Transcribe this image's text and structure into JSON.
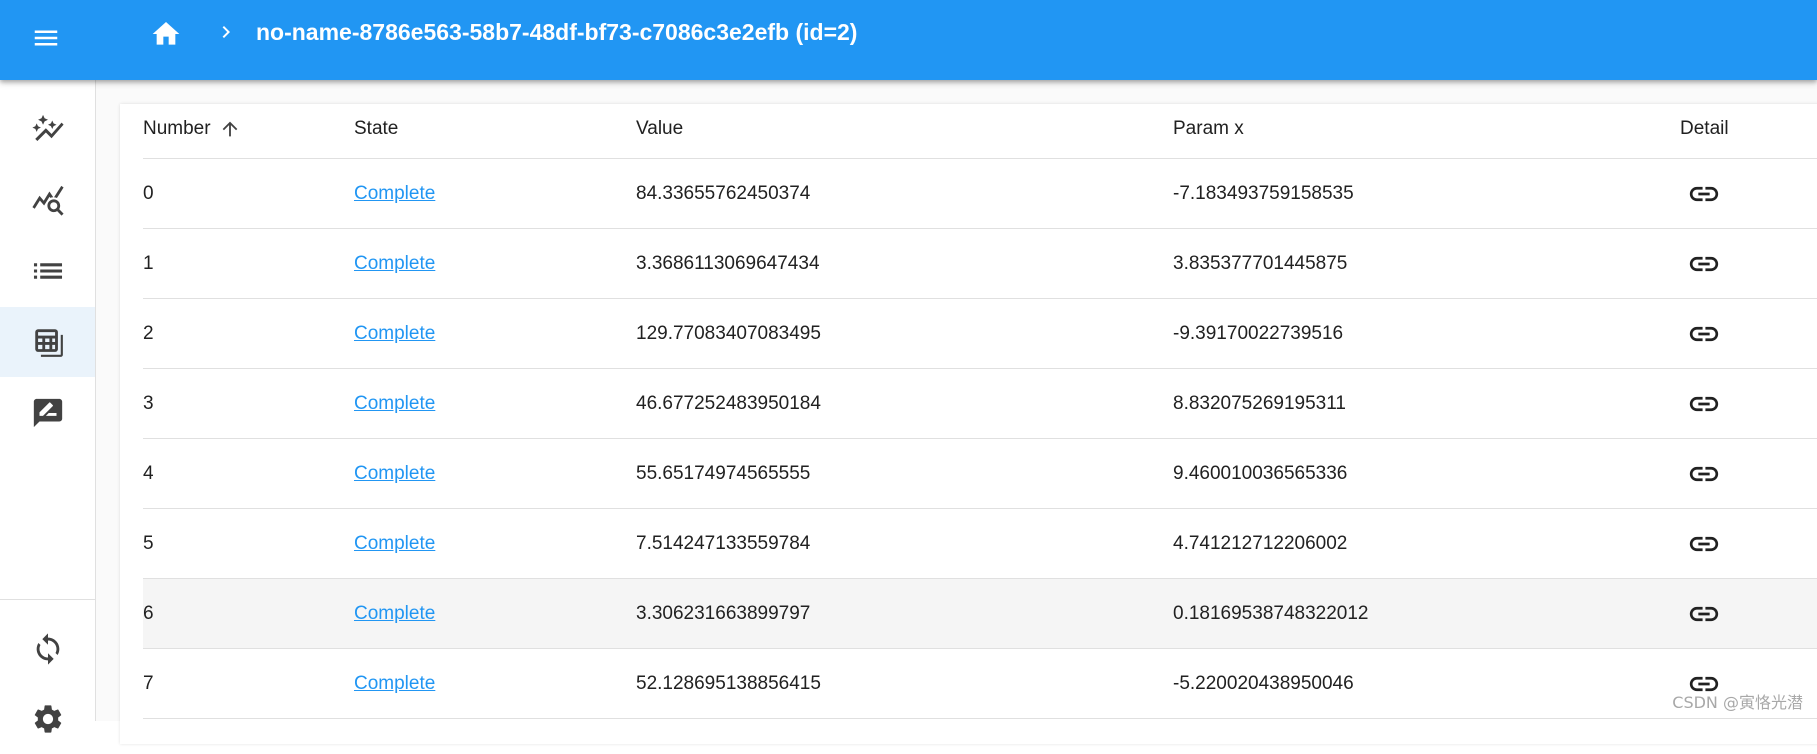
{
  "header": {
    "title": "no-name-8786e563-58b7-48df-bf73-c7086c3e2efb (id=2)"
  },
  "sidebar": {
    "items": [
      {
        "icon": "auto-graph-icon"
      },
      {
        "icon": "query-stats-icon"
      },
      {
        "icon": "list-icon"
      },
      {
        "icon": "table-icon",
        "selected": true
      },
      {
        "icon": "rate-review-icon"
      }
    ],
    "bottom_items": [
      {
        "icon": "sync-icon"
      },
      {
        "icon": "settings-icon"
      }
    ]
  },
  "table": {
    "columns": {
      "number": "Number",
      "state": "State",
      "value": "Value",
      "param": "Param x",
      "detail": "Detail"
    },
    "sort": {
      "column": "number",
      "direction": "ascending"
    },
    "rows": [
      {
        "number": "0",
        "state": "Complete",
        "value": "84.33655762450374",
        "param": "-7.183493759158535"
      },
      {
        "number": "1",
        "state": "Complete",
        "value": "3.3686113069647434",
        "param": "3.835377701445875"
      },
      {
        "number": "2",
        "state": "Complete",
        "value": "129.77083407083495",
        "param": "-9.39170022739516"
      },
      {
        "number": "3",
        "state": "Complete",
        "value": "46.677252483950184",
        "param": "8.832075269195311"
      },
      {
        "number": "4",
        "state": "Complete",
        "value": "55.65174974565555",
        "param": "9.460010036565336"
      },
      {
        "number": "5",
        "state": "Complete",
        "value": "7.514247133559784",
        "param": "4.741212712206002"
      },
      {
        "number": "6",
        "state": "Complete",
        "value": "3.306231663899797",
        "param": "0.18169538748322012"
      },
      {
        "number": "7",
        "state": "Complete",
        "value": "52.128695138856415",
        "param": "-5.220020438950046"
      }
    ]
  },
  "watermark": "CSDN @寅恪光潜",
  "colors": {
    "primary": "#2196f3",
    "selected_nav": "#eaf3fb",
    "row_hover": "#f5f5f5"
  }
}
